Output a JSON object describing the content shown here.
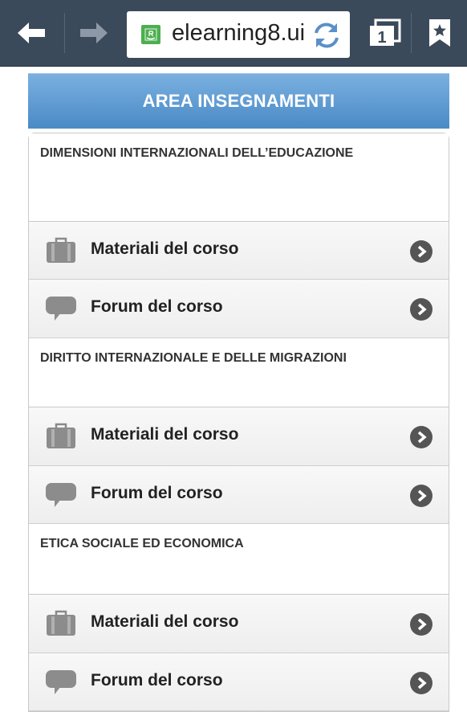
{
  "browser": {
    "url": "elearning8.ui",
    "tab_count": "1"
  },
  "header": {
    "title": "AREA INSEGNAMENTI"
  },
  "sections": [
    {
      "title": "DIMENSIONI INTERNAZIONALI DELL’EDUCAZIONE",
      "materials_label": "Materiali del corso",
      "forum_label": "Forum del corso"
    },
    {
      "title": "DIRITTO INTERNAZIONALE E DELLE MIGRAZIONI",
      "materials_label": "Materiali del corso",
      "forum_label": "Forum del corso"
    },
    {
      "title": "ETICA SOCIALE ED ECONOMICA",
      "materials_label": "Materiali del corso",
      "forum_label": "Forum del corso"
    }
  ],
  "colors": {
    "toolbar": "#3b4a5a",
    "header_gradient_top": "#7ab0e0",
    "header_gradient_bottom": "#4a8ac6"
  },
  "icons": {
    "back": "arrow-left-icon",
    "forward": "arrow-right-icon",
    "site": "site-favicon-icon",
    "reload": "reload-icon",
    "tabs": "tabs-icon",
    "bookmark": "bookmark-star-icon",
    "materials": "briefcase-icon",
    "forum": "speech-bubble-icon",
    "chevron": "chevron-right-circle-icon"
  }
}
